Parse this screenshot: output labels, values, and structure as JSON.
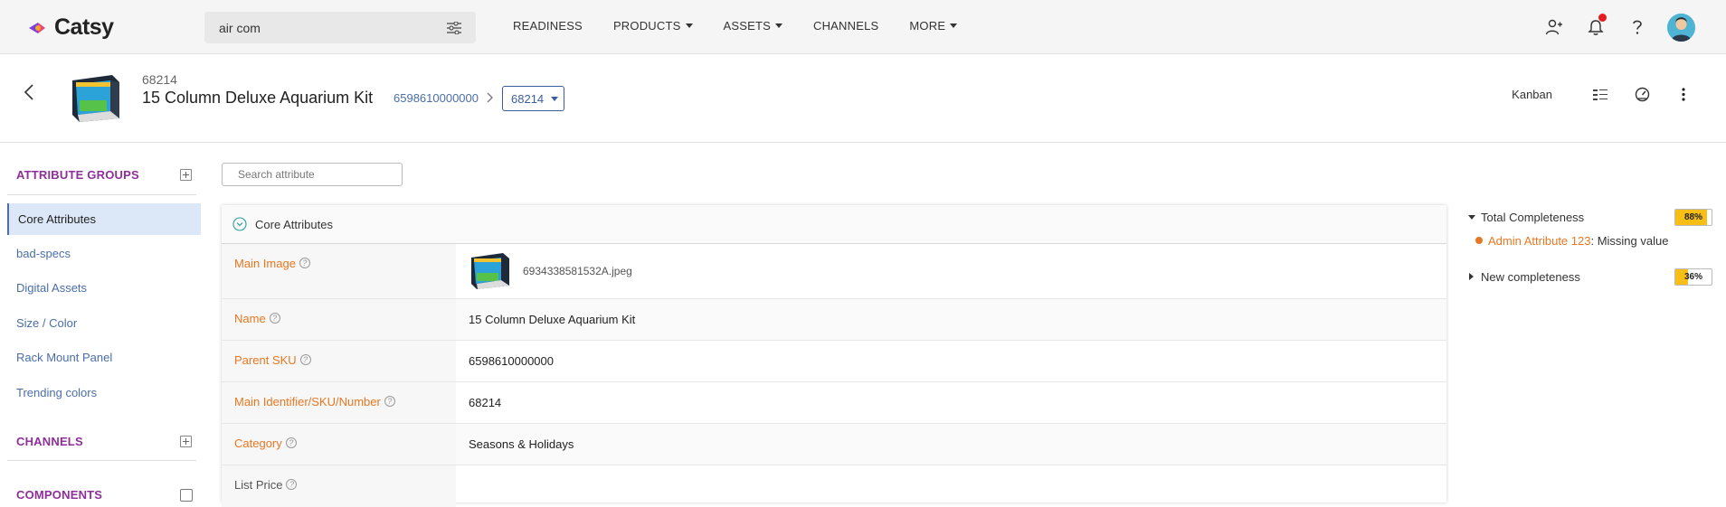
{
  "app": {
    "logo_text": "Catsy"
  },
  "search": {
    "value": "air com"
  },
  "nav": [
    {
      "label": "READINESS",
      "dropdown": false
    },
    {
      "label": "PRODUCTS",
      "dropdown": true
    },
    {
      "label": "ASSETS",
      "dropdown": true
    },
    {
      "label": "CHANNELS",
      "dropdown": false
    },
    {
      "label": "MORE",
      "dropdown": true
    }
  ],
  "top_icons": [
    "add-user-icon",
    "bell-icon",
    "help-icon",
    "avatar"
  ],
  "product": {
    "id": "68214",
    "name": "15 Column Deluxe Aquarium Kit",
    "parent_sku": "6598610000000",
    "variant": "68214"
  },
  "header_actions": {
    "kanban": "Kanban"
  },
  "sidebar": {
    "attribute_groups_title": "ATTRIBUTE GROUPS",
    "items": [
      {
        "label": "Core Attributes",
        "active": true
      },
      {
        "label": "bad-specs"
      },
      {
        "label": "Digital Assets"
      },
      {
        "label": "Size / Color"
      },
      {
        "label": "Rack Mount Panel"
      },
      {
        "label": "Trending colors"
      }
    ],
    "channels_title": "CHANNELS",
    "components_title": "COMPONENTS"
  },
  "attr_search": {
    "placeholder": "Search attribute"
  },
  "panel": {
    "title": "Core Attributes",
    "rows": [
      {
        "label": "Main Image",
        "value": "6934338581532A.jpeg"
      },
      {
        "label": "Name",
        "value": "15 Column Deluxe Aquarium Kit"
      },
      {
        "label": "Parent SKU",
        "value": "6598610000000"
      },
      {
        "label": "Main Identifier/SKU/Number",
        "value": "68214"
      },
      {
        "label": "Category",
        "value": "Seasons & Holidays"
      },
      {
        "label": "List Price",
        "value": ""
      }
    ]
  },
  "completeness": {
    "total": {
      "label": "Total Completeness",
      "value": "88%",
      "fraction": 0.88
    },
    "missing": {
      "attribute": "Admin Attribute 123",
      "message": ": Missing value"
    },
    "new": {
      "label": "New completeness",
      "value": "36%",
      "fraction": 0.36
    }
  },
  "colors": {
    "accent_purple": "#8e2f9a",
    "label_orange": "#e87722",
    "link_blue": "#4a6ea9",
    "badge_yellow": "#f7be16"
  }
}
